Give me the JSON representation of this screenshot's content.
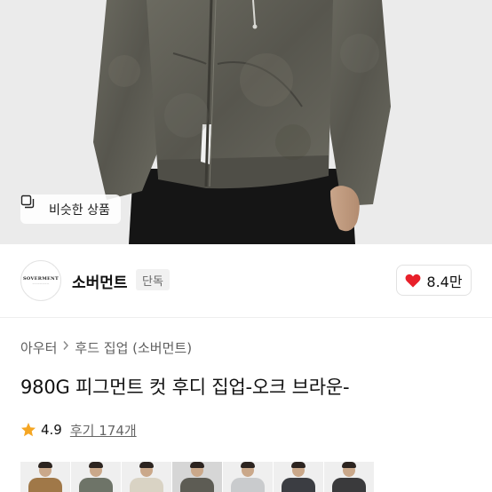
{
  "hero": {
    "similar_button_label": "비슷한 상품",
    "similar_icon": "similar-items-icon",
    "hoodie_color": "#5d5c54"
  },
  "brand": {
    "logo_text": "SOVERMENT",
    "name": "소버먼트",
    "badge": "단독",
    "like_count": "8.4만",
    "like_icon": "heart-icon",
    "heart_color": "#e8202a"
  },
  "breadcrumb": {
    "items": [
      "아우터",
      "후드 집업 (소버먼트)"
    ],
    "separator_icon": "chevron-right-icon"
  },
  "product": {
    "title": "980G 피그먼트 컷 후디 집업-오크 브라운-"
  },
  "rating": {
    "star_icon": "star-icon",
    "star_color": "#f5a623",
    "score": "4.9",
    "reviews": "후기 174개"
  },
  "variants": {
    "colors": [
      "#a07848",
      "#6e7468",
      "#d9d3c4",
      "#5d5c54",
      "#c9cbcd",
      "#3b3d42",
      "#3a3a3c"
    ],
    "selected_index": 3
  }
}
